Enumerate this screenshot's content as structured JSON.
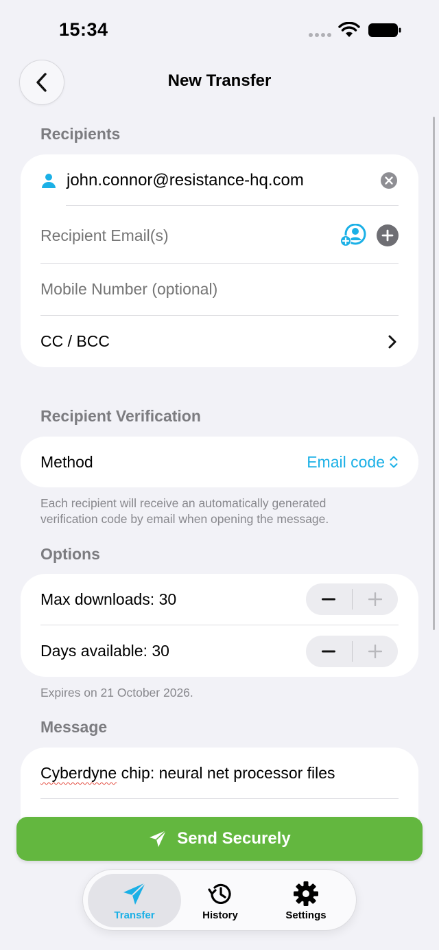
{
  "status_bar": {
    "time": "15:34"
  },
  "nav": {
    "title": "New Transfer",
    "back_icon": "chevron-left-icon"
  },
  "recipients": {
    "header": "Recipients",
    "added_email": "john.connor@resistance-hq.com",
    "email_placeholder": "Recipient Email(s)",
    "mobile_placeholder": "Mobile Number (optional)",
    "cc_bcc_label": "CC / BCC"
  },
  "verification": {
    "header": "Recipient Verification",
    "method_label": "Method",
    "method_value": "Email code",
    "note_line1": "Each recipient will receive an automatically generated",
    "note_line2": "verification code by email when opening the message."
  },
  "options": {
    "header": "Options",
    "max_downloads_label": "Max downloads: 30",
    "days_available_label": "Days available: 30",
    "expiry_note": "Expires on 21 October 2026."
  },
  "message": {
    "header": "Message",
    "subject_misspelled": "Cyberdyne",
    "subject_rest": " chip: neural net processor files"
  },
  "send_button": {
    "label": "Send Securely"
  },
  "tab_bar": {
    "tabs": [
      {
        "label": "Transfer",
        "icon": "paper-plane-icon",
        "active": true
      },
      {
        "label": "History",
        "icon": "history-icon",
        "active": false
      },
      {
        "label": "Settings",
        "icon": "gear-icon",
        "active": false
      }
    ]
  },
  "colors": {
    "accent": "#1bb0e6",
    "send_green": "#63b73f",
    "background": "#f2f2f7"
  }
}
